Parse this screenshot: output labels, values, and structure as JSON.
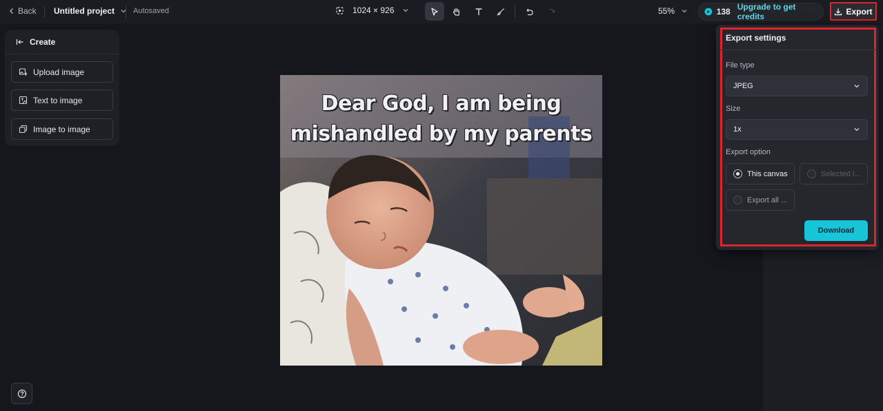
{
  "colors": {
    "accent": "#18c4d8",
    "highlight_frame": "#e0242d",
    "background": "#16171c"
  },
  "topbar": {
    "back_label": "Back",
    "project_name": "Untitled project",
    "save_status": "Autosaved",
    "canvas_size": "1024 × 926",
    "zoom": "55%",
    "credits": "138",
    "upgrade_label": "Upgrade to get credits",
    "export_label": "Export"
  },
  "tools": [
    {
      "icon": "select-pointer-icon",
      "active": true
    },
    {
      "icon": "hand-pan-icon",
      "active": false
    },
    {
      "icon": "text-tool-icon",
      "active": false
    },
    {
      "icon": "brush-icon",
      "active": false
    },
    {
      "icon": "undo-icon",
      "active": false
    },
    {
      "icon": "redo-icon",
      "active": false
    }
  ],
  "create_panel": {
    "title": "Create",
    "items": [
      {
        "label": "Upload image",
        "icon": "upload-image-icon"
      },
      {
        "label": "Text to image",
        "icon": "text-to-image-icon"
      },
      {
        "label": "Image to image",
        "icon": "image-to-image-icon"
      }
    ]
  },
  "canvas": {
    "caption": "Dear God, I am being mishandled by my parents"
  },
  "export_settings": {
    "title": "Export settings",
    "file_type_label": "File type",
    "file_type_value": "JPEG",
    "size_label": "Size",
    "size_value": "1x",
    "export_option_label": "Export option",
    "options": [
      {
        "label": "This canvas",
        "selected": true,
        "enabled": true
      },
      {
        "label": "Selected l...",
        "selected": false,
        "enabled": false
      },
      {
        "label": "Export all ...",
        "selected": false,
        "enabled": true
      }
    ],
    "download_label": "Download"
  }
}
